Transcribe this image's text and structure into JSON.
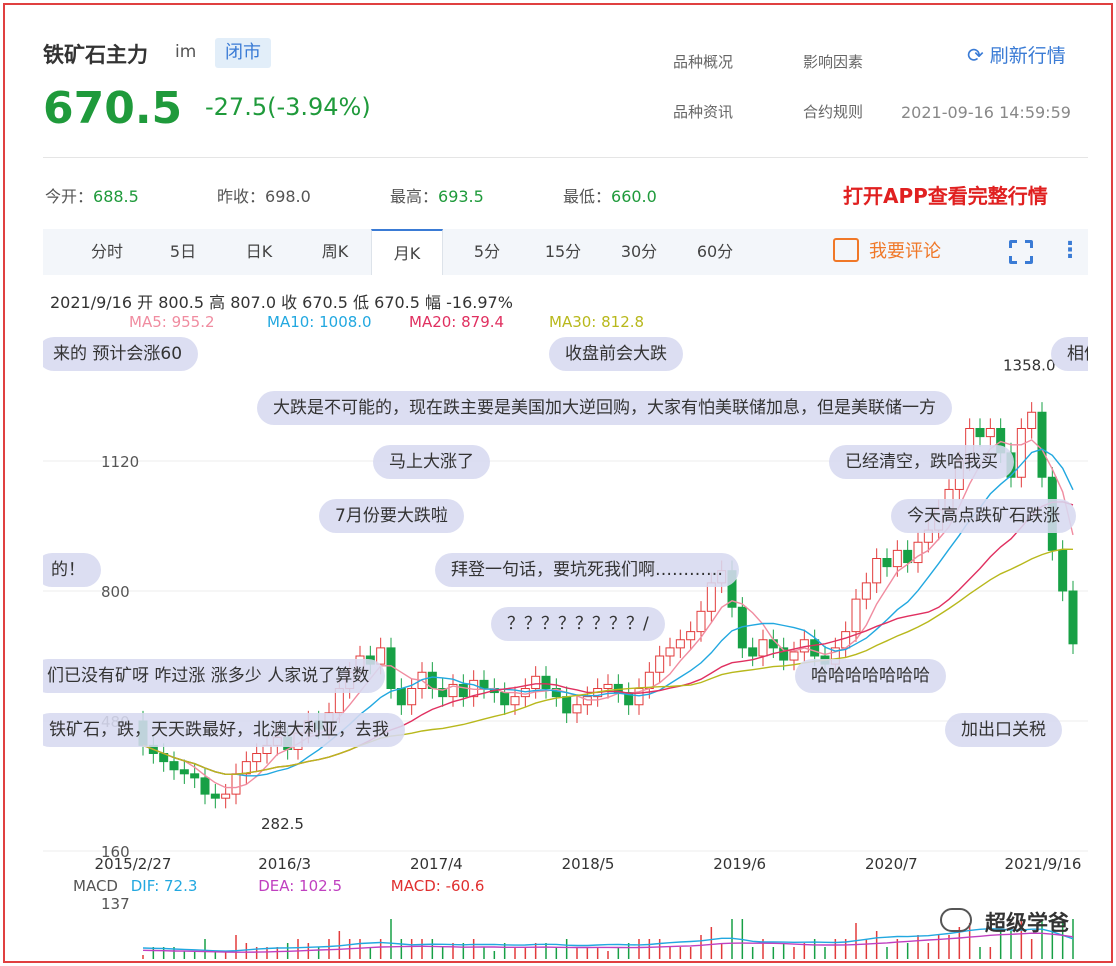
{
  "header": {
    "title": "铁矿石主力",
    "code": "im",
    "status": "闭市",
    "price": "670.5",
    "change": "-27.5(-3.94%)",
    "links": [
      "品种概况",
      "影响因素",
      "品种资讯",
      "合约规则"
    ],
    "refresh": "刷新行情",
    "timestamp": "2021-09-16 14:59:59"
  },
  "stats": {
    "open_label": "今开：",
    "open": "688.5",
    "prev_label": "昨收：",
    "prev": "698.0",
    "high_label": "最高：",
    "high": "693.5",
    "low_label": "最低：",
    "low": "660.0",
    "app_link": "打开APP查看完整行情"
  },
  "tabs": [
    "分时",
    "5日",
    "日K",
    "周K",
    "月K",
    "5分",
    "15分",
    "30分",
    "60分"
  ],
  "active_tab": "月K",
  "comment_button": "我要评论",
  "ohlc_line": "2021/9/16 开 800.5 高 807.0 收 670.5 低 670.5 幅 -16.97%",
  "ma": {
    "ma5": "MA5: 955.2",
    "ma10": "MA10: 1008.0",
    "ma20": "MA20: 879.4",
    "ma30": "MA30: 812.8"
  },
  "colors": {
    "up": "#e23b3b",
    "down": "#17a045",
    "ma5": "#f08ca0",
    "ma10": "#22a8e0",
    "ma20": "#e03060",
    "ma30": "#b8b81c",
    "accent": "#3a7bd5"
  },
  "danmaku": [
    "来的 预计会涨60",
    "收盘前会大跌",
    "相信",
    "大跌是不可能的，现在跌主要是美国加大逆回购，大家有怕美联储加息，但是美联储一方",
    "马上大涨了",
    "已经清空，跌哈我买",
    "7月份要大跌啦",
    "今天高点跌矿石跌涨",
    "的！",
    "拜登一句话，要坑死我们啊…………",
    "？？？？？？？？/",
    "们已没有矿呀 咋过涨 涨多少 人家说了算数",
    "哈哈哈哈哈哈哈",
    "铁矿石，跌，天天跌最好，北澳大利亚，去我",
    "加出口关税"
  ],
  "macd": {
    "label": "MACD",
    "dif": "DIF: 72.3",
    "dea": "DEA: 102.5",
    "macd": "MACD: -60.6",
    "axis_top": "137"
  },
  "logo": "超级学爸",
  "chart_data": {
    "type": "candlestick",
    "price_ticks": [
      1120,
      800,
      480,
      160
    ],
    "max_label": "1358.0",
    "min_label": "282.5",
    "x_labels": [
      "2015/2/27",
      "2016/3",
      "2017/4",
      "2018/5",
      "2019/6",
      "2020/7",
      "2021/9/16"
    ],
    "y_range": [
      160,
      1440
    ],
    "candles": [
      [
        480,
        420
      ],
      [
        420,
        400
      ],
      [
        400,
        380
      ],
      [
        380,
        360
      ],
      [
        360,
        350
      ],
      [
        350,
        340
      ],
      [
        340,
        300
      ],
      [
        300,
        290
      ],
      [
        290,
        300
      ],
      [
        300,
        350
      ],
      [
        350,
        380
      ],
      [
        380,
        400
      ],
      [
        400,
        420
      ],
      [
        420,
        440
      ],
      [
        440,
        410
      ],
      [
        410,
        450
      ],
      [
        450,
        480
      ],
      [
        480,
        460
      ],
      [
        460,
        500
      ],
      [
        500,
        560
      ],
      [
        560,
        600
      ],
      [
        600,
        640
      ],
      [
        640,
        620
      ],
      [
        620,
        660
      ],
      [
        660,
        560
      ],
      [
        560,
        520
      ],
      [
        520,
        560
      ],
      [
        560,
        600
      ],
      [
        600,
        560
      ],
      [
        560,
        540
      ],
      [
        540,
        570
      ],
      [
        570,
        540
      ],
      [
        540,
        580
      ],
      [
        580,
        560
      ],
      [
        560,
        550
      ],
      [
        550,
        520
      ],
      [
        520,
        540
      ],
      [
        540,
        560
      ],
      [
        560,
        590
      ],
      [
        590,
        560
      ],
      [
        560,
        540
      ],
      [
        540,
        500
      ],
      [
        500,
        520
      ],
      [
        520,
        540
      ],
      [
        540,
        560
      ],
      [
        560,
        570
      ],
      [
        570,
        550
      ],
      [
        550,
        520
      ],
      [
        520,
        560
      ],
      [
        560,
        600
      ],
      [
        600,
        640
      ],
      [
        640,
        660
      ],
      [
        660,
        680
      ],
      [
        680,
        700
      ],
      [
        700,
        750
      ],
      [
        750,
        820
      ],
      [
        820,
        850
      ],
      [
        850,
        760
      ],
      [
        760,
        660
      ],
      [
        660,
        640
      ],
      [
        640,
        680
      ],
      [
        680,
        660
      ],
      [
        660,
        630
      ],
      [
        630,
        650
      ],
      [
        650,
        680
      ],
      [
        680,
        640
      ],
      [
        640,
        620
      ],
      [
        620,
        660
      ],
      [
        660,
        700
      ],
      [
        700,
        780
      ],
      [
        780,
        820
      ],
      [
        820,
        880
      ],
      [
        880,
        860
      ],
      [
        860,
        900
      ],
      [
        900,
        870
      ],
      [
        870,
        920
      ],
      [
        920,
        950
      ],
      [
        950,
        1000
      ],
      [
        1000,
        1050
      ],
      [
        1050,
        1120
      ],
      [
        1120,
        1200
      ],
      [
        1200,
        1180
      ],
      [
        1180,
        1200
      ],
      [
        1200,
        1140
      ],
      [
        1140,
        1080
      ],
      [
        1080,
        1200
      ],
      [
        1200,
        1240
      ],
      [
        1240,
        1080
      ],
      [
        1080,
        900
      ],
      [
        900,
        800
      ],
      [
        800,
        670
      ]
    ]
  }
}
